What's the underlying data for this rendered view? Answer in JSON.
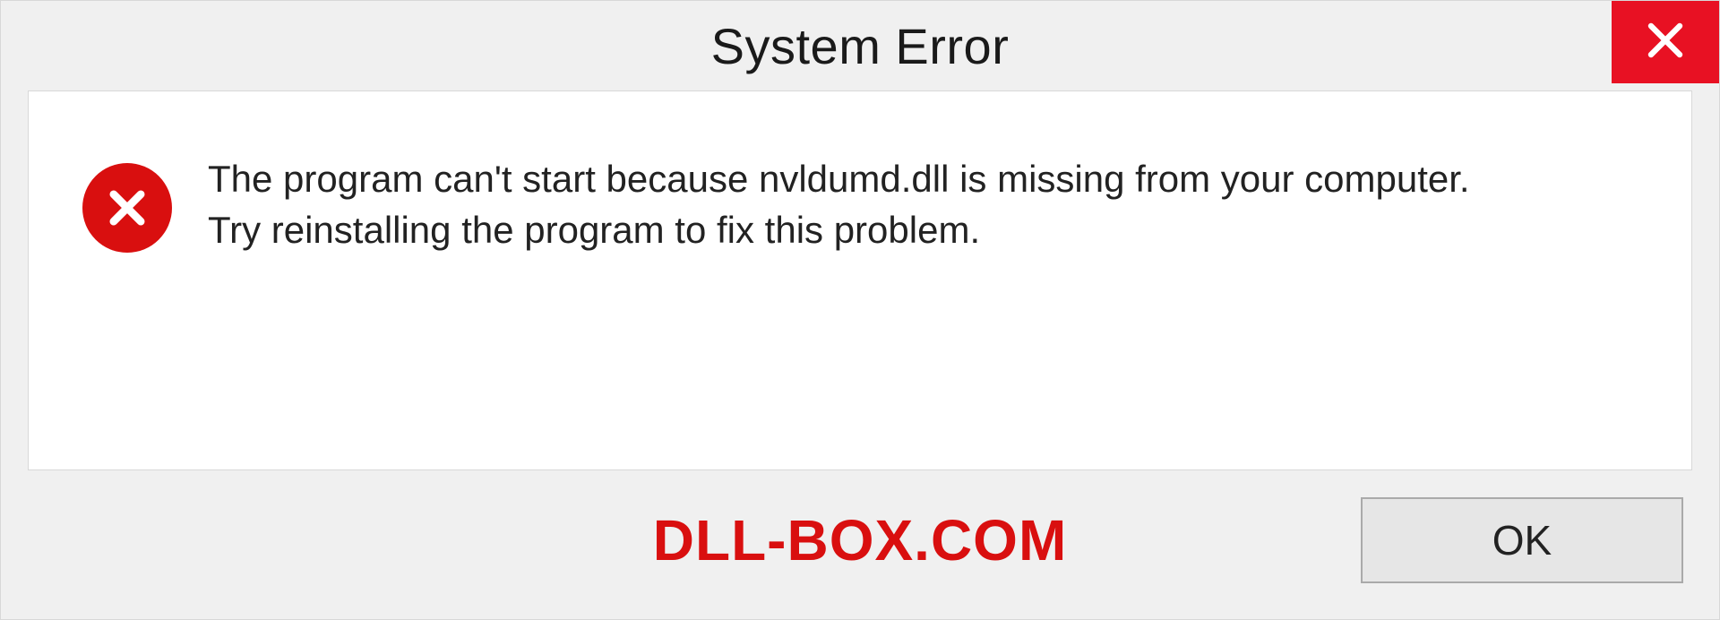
{
  "titlebar": {
    "title": "System Error",
    "close_icon": "close"
  },
  "content": {
    "error_icon": "error-circle-x",
    "message_line1": "The program can't start because nvldumd.dll is missing from your computer.",
    "message_line2": "Try reinstalling the program to fix this problem."
  },
  "footer": {
    "watermark": "DLL-BOX.COM",
    "ok_label": "OK"
  },
  "colors": {
    "accent_red": "#d90f0f",
    "close_red": "#e81123",
    "panel_bg": "#f0f0f0"
  }
}
